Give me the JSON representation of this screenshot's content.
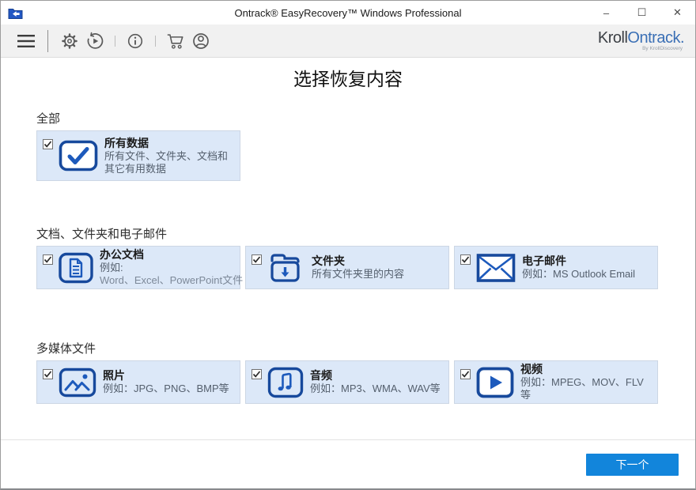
{
  "window": {
    "title": "Ontrack® EasyRecovery™ Windows Professional",
    "controls": {
      "minimize": "–",
      "maximize": "☐",
      "close": "✕"
    }
  },
  "toolbar": {
    "icons": [
      "menu",
      "settings",
      "history",
      "info",
      "cart",
      "account"
    ]
  },
  "logo": {
    "kroll": "Kroll",
    "ontrack": "Ontrack.",
    "byline": "By KrollDiscovery"
  },
  "page": {
    "heading": "选择恢复内容"
  },
  "sections": [
    {
      "label": "全部",
      "cards": [
        {
          "icon": "all-data-icon",
          "title": "所有数据",
          "desc1": "所有文件、文件夹、文档和其它有用数据",
          "checked": true
        }
      ]
    },
    {
      "label": "文档、文件夹和电子邮件",
      "cards": [
        {
          "icon": "office-document-icon",
          "title": "办公文档",
          "desc1": "例如:",
          "desc2": "Word、Excel、PowerPoint文件",
          "checked": true
        },
        {
          "icon": "folder-icon",
          "title": "文件夹",
          "desc1": "所有文件夹里的内容",
          "checked": true
        },
        {
          "icon": "email-icon",
          "title": "电子邮件",
          "desc1": "例如：MS Outlook Email",
          "checked": true
        }
      ]
    },
    {
      "label": "多媒体文件",
      "cards": [
        {
          "icon": "photo-icon",
          "title": "照片",
          "desc1": "例如：JPG、PNG、BMP等",
          "checked": true
        },
        {
          "icon": "audio-icon",
          "title": "音频",
          "desc1": "例如：MP3、WMA、WAV等",
          "checked": true
        },
        {
          "icon": "video-icon",
          "title": "视频",
          "desc1": "例如：MPEG、MOV、FLV等",
          "checked": true
        }
      ]
    }
  ],
  "footer": {
    "next_label": "下一个"
  },
  "colors": {
    "accent_blue": "#1285db",
    "icon_dark_blue": "#17499c",
    "icon_mid_blue": "#1d5abc",
    "card_bg": "#dce8f8",
    "toolbar_bg": "#f1f1f1"
  }
}
